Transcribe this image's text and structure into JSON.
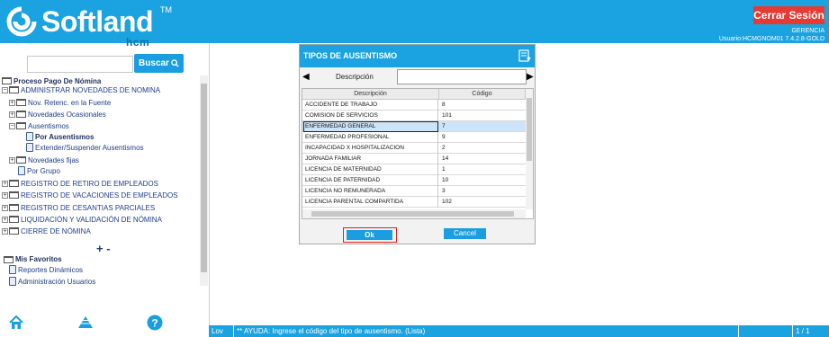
{
  "header": {
    "logo_text": "Softland",
    "logo_tm": "TM",
    "logo_sub": "hcm",
    "logout_label": "Cerrar Sesión",
    "company": "GERENCIA",
    "user": "Usuario:HCMGNOM01 7.4.2.8-GOLD",
    "brand_color": "#1aa3e0"
  },
  "search": {
    "placeholder": "",
    "button_label": "Buscar"
  },
  "tree": {
    "root": "Proceso Pago De Nómina",
    "items": [
      {
        "label": "ADMINISTRAR NOVEDADES DE NOMINA"
      },
      {
        "label": "Nov. Retenc. en la Fuente"
      },
      {
        "label": "Novedades Ocasionales"
      },
      {
        "label": "Ausentismos"
      },
      {
        "label": "Por Ausentismos"
      },
      {
        "label": "Extender/Suspender Ausentismos"
      },
      {
        "label": "Novedades fijas"
      },
      {
        "label": "Por Grupo"
      },
      {
        "label": "REGISTRO DE RETIRO DE EMPLEADOS"
      },
      {
        "label": "REGISTRO DE VACACIONES DE EMPLEADOS"
      },
      {
        "label": "REGISTRO DE CESANTIAS PARCIALES"
      },
      {
        "label": "LIQUIDACIÓN Y VALIDACIÓN DE NÓMINA"
      },
      {
        "label": "CIERRE DE NÓMINA"
      }
    ],
    "plusminus": "+ -",
    "favorites_title": "Mis Favoritos",
    "favorites": [
      {
        "label": "Reportes Dinámicos"
      },
      {
        "label": "Administración Usuarios"
      }
    ]
  },
  "dialog": {
    "title": "TIPOS DE AUSENTISMO",
    "prev": "◀",
    "next": "▶",
    "desc_label": "Descripción",
    "desc_value": "",
    "columns": [
      "Descripción",
      "Código"
    ],
    "rows": [
      {
        "desc": "ACCIDENTE DE TRABAJO",
        "code": "8"
      },
      {
        "desc": "COMISION DE SERVICIOS",
        "code": "101"
      },
      {
        "desc": "ENFERMEDAD GENERAL",
        "code": "7"
      },
      {
        "desc": "ENFERMEDAD PROFESIONAL",
        "code": "9"
      },
      {
        "desc": "INCAPACIDAD X HOSPITALIZACION",
        "code": "2"
      },
      {
        "desc": "JORNADA FAMILIAR",
        "code": "14"
      },
      {
        "desc": "LICENCIA DE MATERNIDAD",
        "code": "1"
      },
      {
        "desc": "LICENCIA DE PATERNIDAD",
        "code": "10"
      },
      {
        "desc": "LICENCIA NO REMUNERADA",
        "code": "3"
      },
      {
        "desc": "LICENCIA PARENTAL COMPARTIDA",
        "code": "102"
      }
    ],
    "selected_row": 2,
    "ok_label": "Ok",
    "cancel_label": "Cancel"
  },
  "status": {
    "lov": "Lov",
    "help": "** AYUDA: Ingrese el código del tipo de ausentismo. (Lista)",
    "page": "1 / 1"
  }
}
